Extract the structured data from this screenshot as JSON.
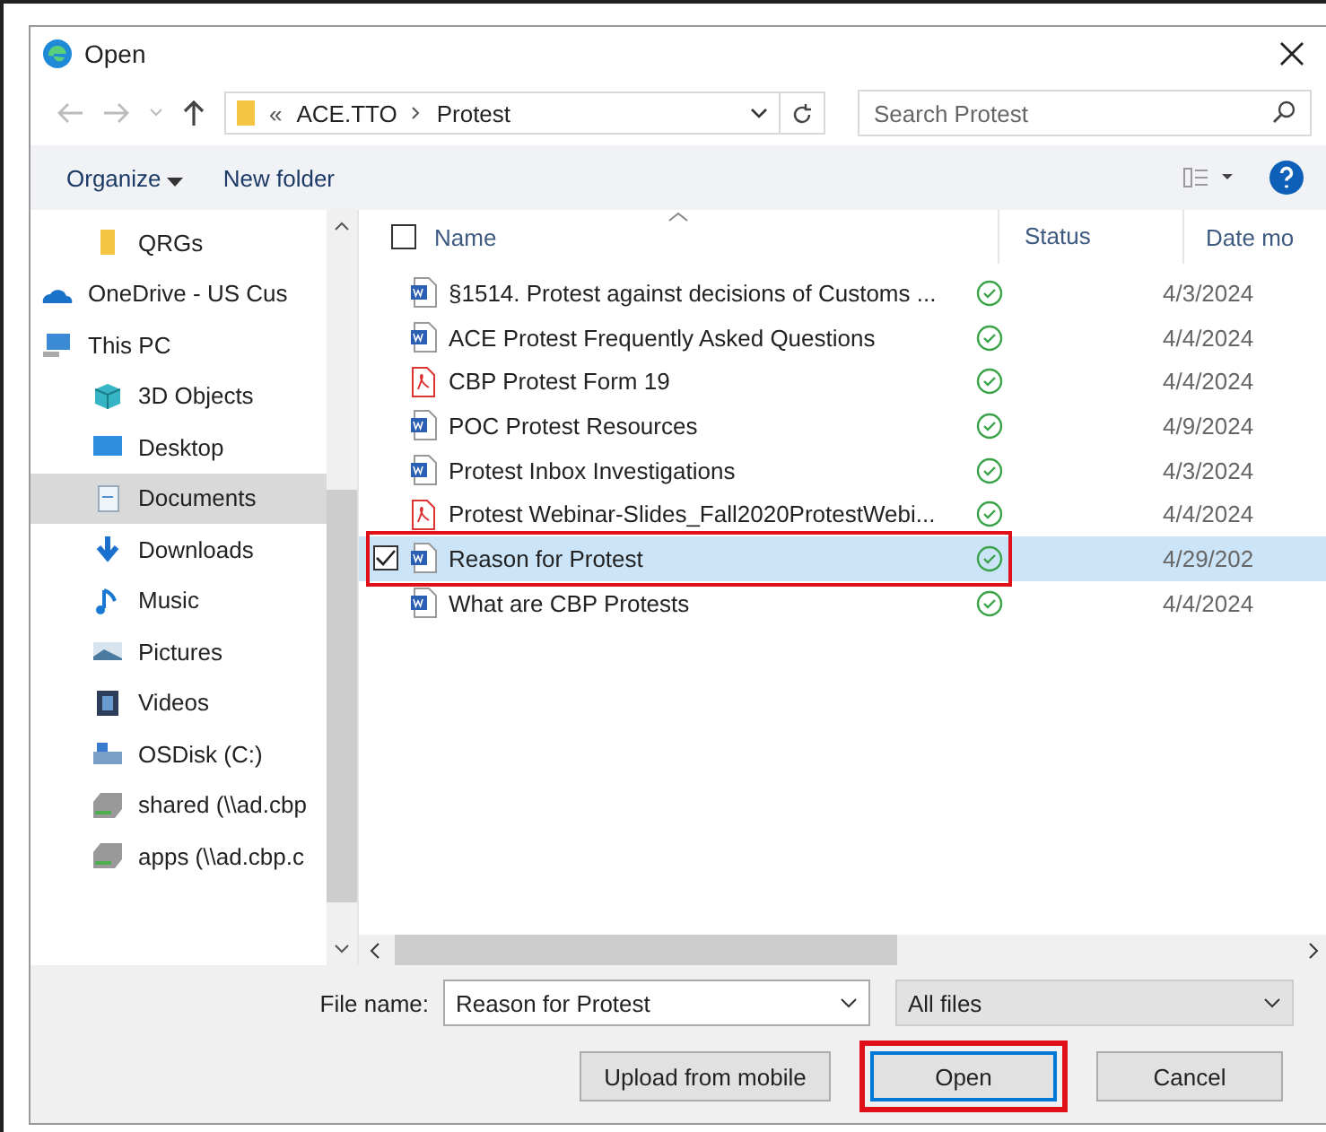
{
  "window": {
    "title": "Open"
  },
  "address": {
    "overflow": "«",
    "path": [
      "ACE.TTO",
      "Protest"
    ],
    "search_placeholder": "Search Protest"
  },
  "toolbar": {
    "organize": "Organize",
    "new_folder": "New folder"
  },
  "sidebar": {
    "items": [
      {
        "label": "QRGs",
        "kind": "folder",
        "selected": false,
        "indent": true
      },
      {
        "label": "OneDrive - US Cus",
        "kind": "cloud",
        "selected": false,
        "indent": false
      },
      {
        "label": "This PC",
        "kind": "pc",
        "selected": false,
        "indent": false
      },
      {
        "label": "3D Objects",
        "kind": "cube",
        "selected": false,
        "indent": true
      },
      {
        "label": "Desktop",
        "kind": "desktop",
        "selected": false,
        "indent": true
      },
      {
        "label": "Documents",
        "kind": "document",
        "selected": true,
        "indent": true
      },
      {
        "label": "Downloads",
        "kind": "download",
        "selected": false,
        "indent": true
      },
      {
        "label": "Music",
        "kind": "music",
        "selected": false,
        "indent": true
      },
      {
        "label": "Pictures",
        "kind": "pictures",
        "selected": false,
        "indent": true
      },
      {
        "label": "Videos",
        "kind": "videos",
        "selected": false,
        "indent": true
      },
      {
        "label": "OSDisk (C:)",
        "kind": "disk",
        "selected": false,
        "indent": true
      },
      {
        "label": "shared (\\\\ad.cbp",
        "kind": "drive",
        "selected": false,
        "indent": true
      },
      {
        "label": "apps (\\\\ad.cbp.c",
        "kind": "drive",
        "selected": false,
        "indent": true
      }
    ]
  },
  "table": {
    "all_selected": false,
    "columns": [
      "Name",
      "Status",
      "Date mo"
    ],
    "rows": [
      {
        "name": "§1514. Protest against decisions of Customs ...",
        "kind": "word",
        "date": "4/3/2024",
        "selected": false,
        "highlighted": false
      },
      {
        "name": "ACE Protest Frequently Asked Questions",
        "kind": "word",
        "date": "4/4/2024",
        "selected": false,
        "highlighted": false
      },
      {
        "name": "CBP Protest Form 19",
        "kind": "pdf",
        "date": "4/4/2024",
        "selected": false,
        "highlighted": false
      },
      {
        "name": "POC Protest Resources",
        "kind": "word",
        "date": "4/9/2024",
        "selected": false,
        "highlighted": false
      },
      {
        "name": "Protest Inbox Investigations",
        "kind": "word",
        "date": "4/3/2024",
        "selected": false,
        "highlighted": false
      },
      {
        "name": "Protest Webinar-Slides_Fall2020ProtestWebi...",
        "kind": "pdf",
        "date": "4/4/2024",
        "selected": false,
        "highlighted": false
      },
      {
        "name": "Reason for Protest",
        "kind": "word",
        "date": "4/29/202",
        "selected": true,
        "highlighted": true
      },
      {
        "name": "What are CBP Protests",
        "kind": "word",
        "date": "4/4/2024",
        "selected": false,
        "highlighted": false
      }
    ]
  },
  "footer": {
    "file_name_label": "File name:",
    "file_name": "Reason for Protest",
    "file_type": "All files",
    "buttons": [
      {
        "label": "Upload from mobile",
        "highlighted": false,
        "default": false
      },
      {
        "label": "Open",
        "highlighted": true,
        "default": true
      },
      {
        "label": "Cancel",
        "highlighted": false,
        "default": false
      }
    ]
  }
}
